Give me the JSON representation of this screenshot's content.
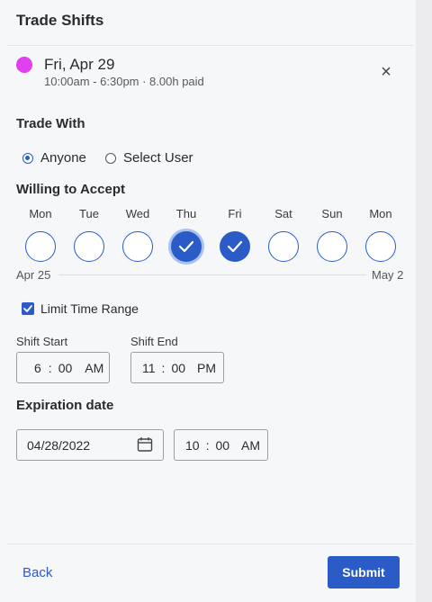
{
  "header": {
    "title": "Trade Shifts"
  },
  "shift": {
    "color": "#e040f0",
    "date": "Fri, Apr 29",
    "details": "10:00am - 6:30pm · 8.00h paid",
    "close_glyph": "×"
  },
  "trade_with": {
    "label": "Trade With",
    "options": [
      {
        "label": "Anyone",
        "selected": true
      },
      {
        "label": "Select User",
        "selected": false
      }
    ]
  },
  "willing": {
    "label": "Willing to Accept",
    "days": [
      {
        "name": "Mon",
        "selected": false
      },
      {
        "name": "Tue",
        "selected": false
      },
      {
        "name": "Wed",
        "selected": false
      },
      {
        "name": "Thu",
        "selected": true
      },
      {
        "name": "Fri",
        "selected": true
      },
      {
        "name": "Sat",
        "selected": false
      },
      {
        "name": "Sun",
        "selected": false
      },
      {
        "name": "Mon",
        "selected": false
      }
    ],
    "range_start": "Apr 25",
    "range_end": "May 2"
  },
  "limit_time": {
    "label": "Limit Time Range",
    "checked": true
  },
  "shift_start": {
    "label": "Shift Start",
    "hour": "6",
    "minute": "00",
    "ampm": "AM"
  },
  "shift_end": {
    "label": "Shift End",
    "hour": "11",
    "minute": "00",
    "ampm": "PM"
  },
  "expiration": {
    "label": "Expiration date",
    "date": "04/28/2022",
    "hour": "10",
    "minute": "00",
    "ampm": "AM"
  },
  "footer": {
    "back_label": "Back",
    "submit_label": "Submit"
  },
  "colors": {
    "accent": "#2a5bc7",
    "shift_dot": "#e040f0"
  }
}
